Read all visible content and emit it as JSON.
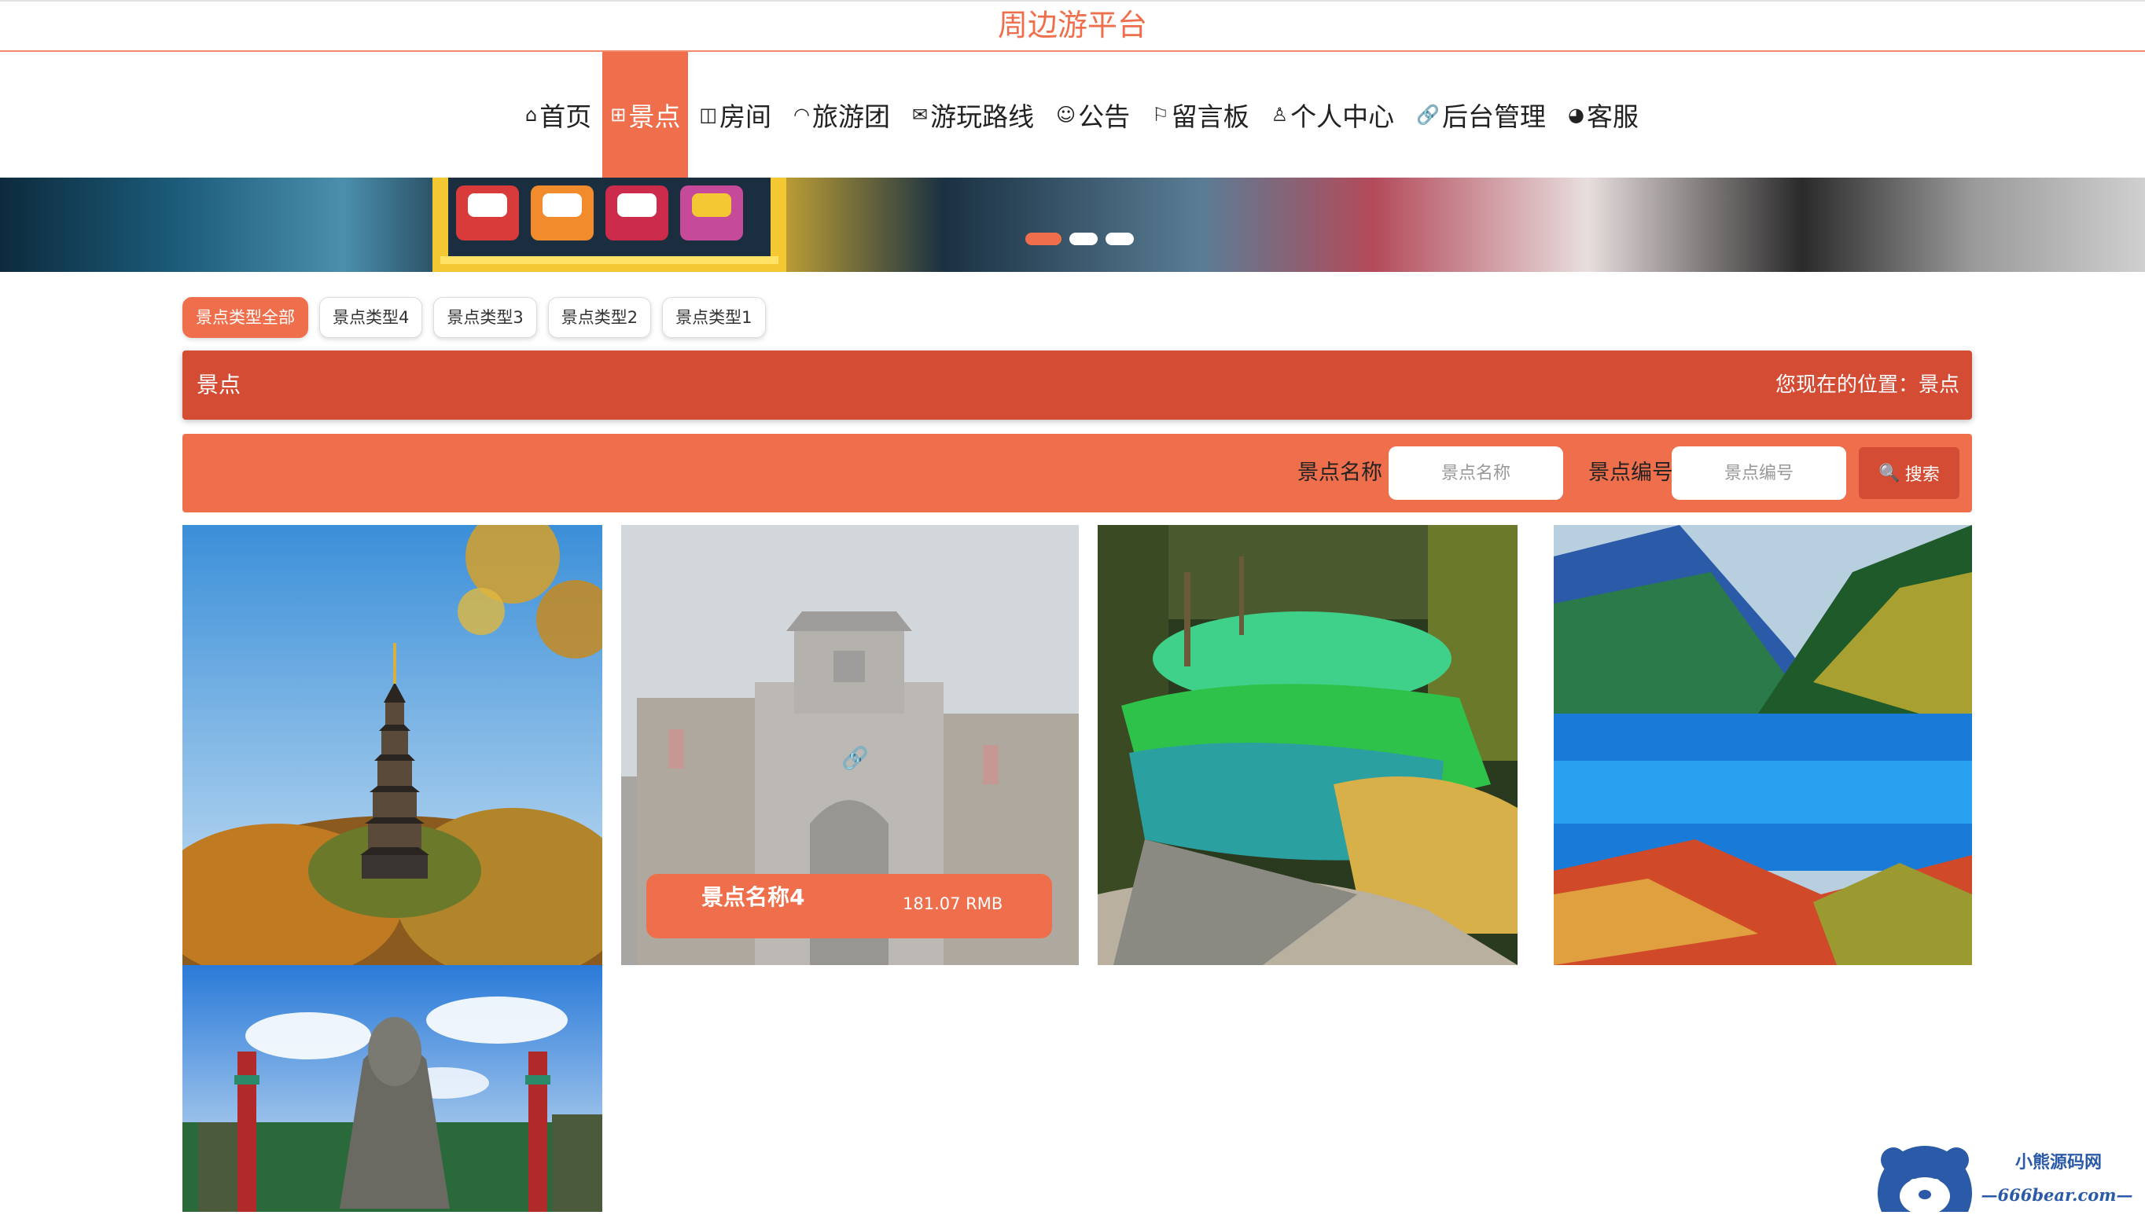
{
  "site": {
    "title": "周边游平台"
  },
  "nav": {
    "items": [
      {
        "label": "首页",
        "icon": "home-icon",
        "glyph": "⌂",
        "active": false
      },
      {
        "label": "景点",
        "icon": "gift-icon",
        "glyph": "⊞",
        "active": true
      },
      {
        "label": "房间",
        "icon": "door-icon",
        "glyph": "◫",
        "active": false
      },
      {
        "label": "旅游团",
        "icon": "dashboard-icon",
        "glyph": "◠",
        "active": false
      },
      {
        "label": "游玩路线",
        "icon": "mail-icon",
        "glyph": "✉",
        "active": false
      },
      {
        "label": "公告",
        "icon": "bell-icon",
        "glyph": "☺",
        "active": false
      },
      {
        "label": "留言板",
        "icon": "flag-icon",
        "glyph": "⚐",
        "active": false
      },
      {
        "label": "个人中心",
        "icon": "user-icon",
        "glyph": "♙",
        "active": false
      },
      {
        "label": "后台管理",
        "icon": "link-icon",
        "glyph": "🔗",
        "active": false
      },
      {
        "label": "客服",
        "icon": "service-icon",
        "glyph": "◕",
        "active": false
      }
    ]
  },
  "carousel": {
    "slides": 3,
    "active_index": 0
  },
  "filters": {
    "chips": [
      {
        "label": "景点类型全部",
        "active": true
      },
      {
        "label": "景点类型4",
        "active": false
      },
      {
        "label": "景点类型3",
        "active": false
      },
      {
        "label": "景点类型2",
        "active": false
      },
      {
        "label": "景点类型1",
        "active": false
      }
    ]
  },
  "breadcrumb": {
    "title": "景点",
    "location": "您现在的位置：景点"
  },
  "search": {
    "name_label": "景点名称",
    "name_placeholder": "景点名称",
    "code_label": "景点编号",
    "code_placeholder": "景点编号",
    "button_label": "搜索"
  },
  "spots": [
    {
      "hover": false,
      "image": "pagoda-photo"
    },
    {
      "hover": true,
      "image": "ancient-gate-photo",
      "name": "景点名称4",
      "price": "181.07 RMB"
    },
    {
      "hover": false,
      "image": "green-pool-photo"
    },
    {
      "hover": false,
      "image": "blue-lake-photo"
    },
    {
      "hover": false,
      "image": "romance-park-photo"
    }
  ],
  "watermark": {
    "line1": "小熊源码网",
    "line2": "—666bear.com—"
  },
  "colors": {
    "accent": "#ef6f4d",
    "accent_dark": "#d44c34"
  }
}
